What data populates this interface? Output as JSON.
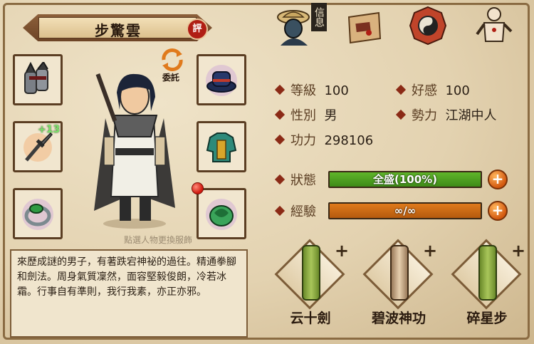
{
  "character": {
    "name": "步驚雲",
    "comment_badge": "評",
    "delegate_label": "委託",
    "change_outfit_hint": "點選人物更換服飾",
    "description": "來歷成謎的男子，有著跌宕神祕的過往。精通拳腳和劍法。周身氣質凜然，面容堅毅俊朗，冷若冰霜。行事自有準則，我行我素，亦正亦邪。"
  },
  "equipment": {
    "weapon_enhance": "+13"
  },
  "tabs": {
    "info_label": "信息"
  },
  "stats": {
    "level_label": "等級",
    "level_value": "100",
    "favor_label": "好感",
    "favor_value": "100",
    "gender_label": "性別",
    "gender_value": "男",
    "faction_label": "勢力",
    "faction_value": "江湖中人",
    "power_label": "功力",
    "power_value": "298106"
  },
  "bars": {
    "status_label": "狀態",
    "status_text": "全盛(100%)",
    "status_fraction": 1.0,
    "exp_label": "經驗",
    "exp_text": "∞/∞",
    "exp_fraction": 1.0
  },
  "skills": [
    {
      "name": "云十劍"
    },
    {
      "name": "碧波神功"
    },
    {
      "name": "碎星步"
    }
  ],
  "colors": {
    "status_bar": "#5fb52a",
    "exp_bar": "#e07a1c",
    "accent_red": "#b01e14"
  }
}
